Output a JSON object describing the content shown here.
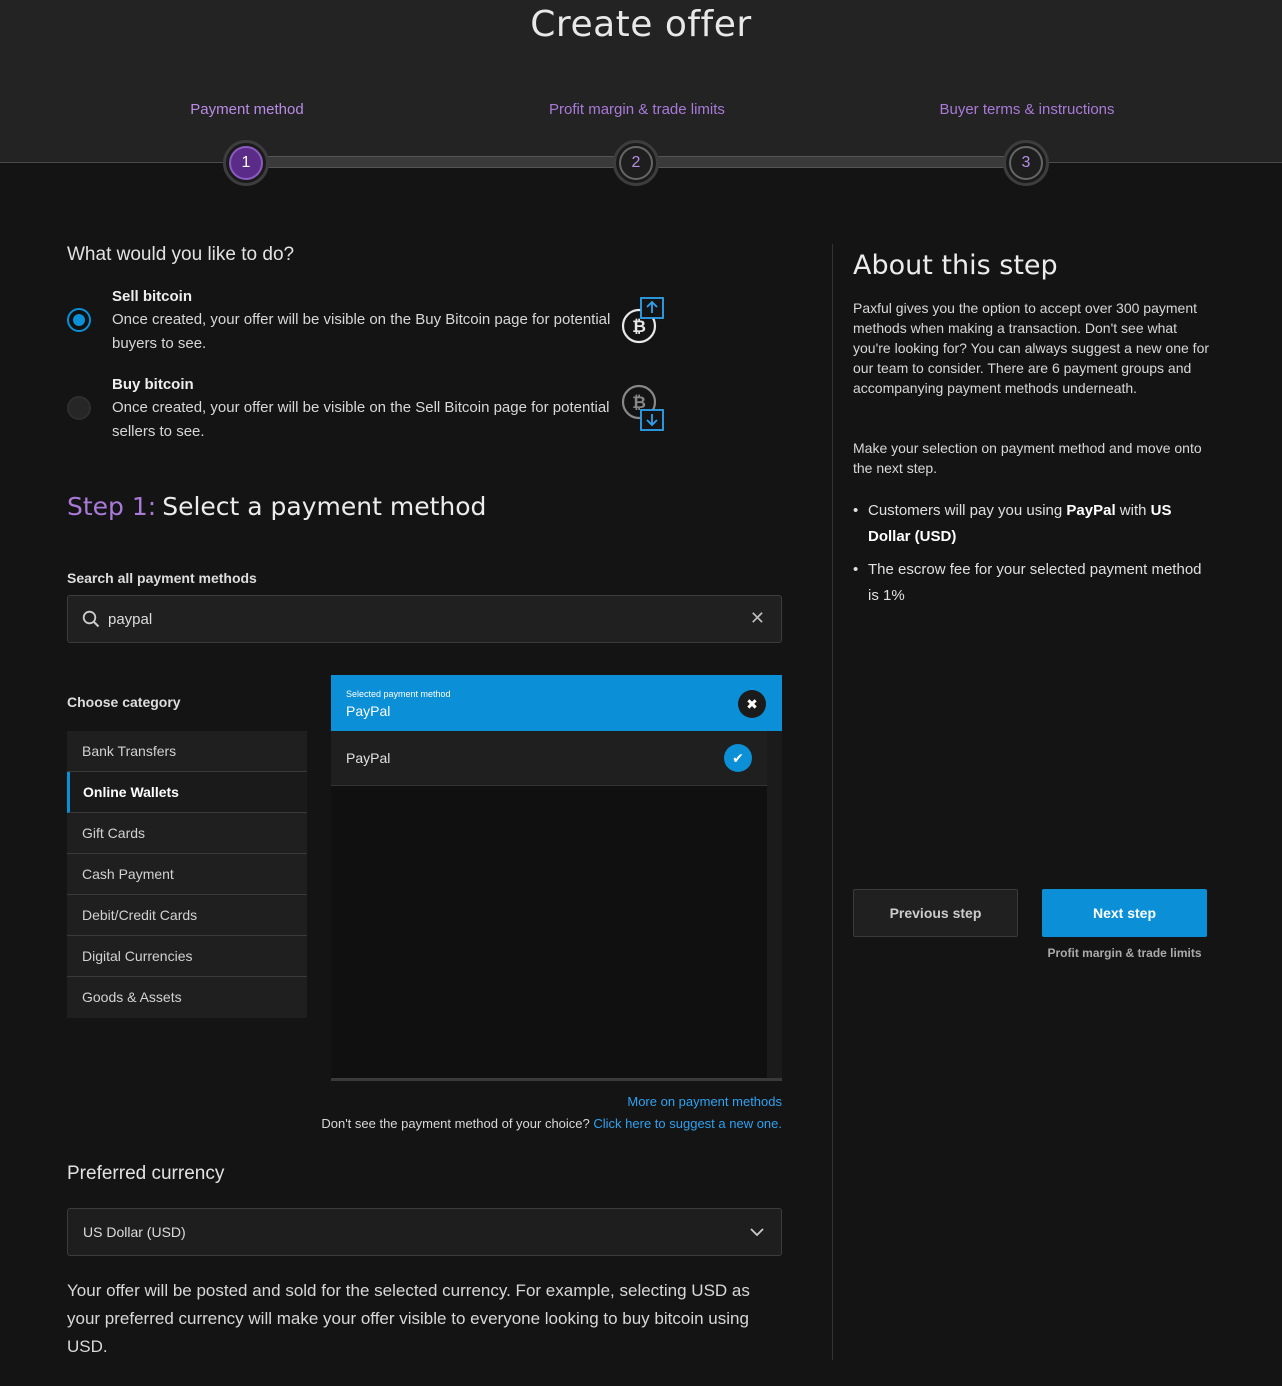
{
  "header": {
    "title": "Create offer",
    "steps": [
      {
        "label": "Payment method",
        "number": "1",
        "active": true
      },
      {
        "label": "Profit margin & trade limits",
        "number": "2",
        "active": false
      },
      {
        "label": "Buyer terms & instructions",
        "number": "3",
        "active": false
      }
    ]
  },
  "action": {
    "question": "What would you like to do?",
    "options": [
      {
        "title": "Sell bitcoin",
        "desc": "Once created, your offer will be visible on the Buy Bitcoin page for potential buyers to see.",
        "selected": true
      },
      {
        "title": "Buy bitcoin",
        "desc": "Once created, your offer will be visible on the Sell Bitcoin page for potential sellers to see.",
        "selected": false
      }
    ]
  },
  "step1": {
    "prefix": "Step 1:",
    "title": "Select a payment method"
  },
  "search": {
    "label": "Search all payment methods",
    "value": "paypal",
    "placeholder": "",
    "clear_icon": "close-icon"
  },
  "categories": {
    "label": "Choose category",
    "items": [
      "Bank Transfers",
      "Online Wallets",
      "Gift Cards",
      "Cash Payment",
      "Debit/Credit Cards",
      "Digital Currencies",
      "Goods & Assets"
    ],
    "active": "Online Wallets"
  },
  "payment_panel": {
    "selected_caption": "Selected payment method",
    "selected_name": "PayPal",
    "results": [
      "PayPal"
    ]
  },
  "links": {
    "more": "More on payment methods",
    "suggest_text": "Don't see the payment method of your choice?",
    "suggest_link": "Click here to suggest a new one."
  },
  "currency": {
    "label": "Preferred currency",
    "value": "US Dollar (USD)",
    "desc": "Your offer will be posted and sold for the selected currency. For example, selecting USD as your preferred currency will make your offer visible to everyone looking to buy bitcoin using USD."
  },
  "about": {
    "title": "About this step",
    "p1": "Paxful gives you the option to accept over 300 payment methods when making a transaction. Don't see what you're looking for? You can always suggest a new one for our team to consider. There are 6 payment groups and accompanying payment methods underneath.",
    "p2": "Make your selection on payment method and move onto the next step.",
    "bullet1": {
      "pre": "Customers will pay you using ",
      "method": "PayPal",
      "mid": " with ",
      "currency": "US Dollar (USD)"
    },
    "bullet2": "The escrow fee for your selected payment method is 1%"
  },
  "nav": {
    "prev": "Previous step",
    "next": "Next step",
    "next_sub": "Profit margin & trade limits"
  },
  "colors": {
    "accent": "#0b8fd6",
    "purple": "#a97ad8",
    "background": "#141414"
  }
}
